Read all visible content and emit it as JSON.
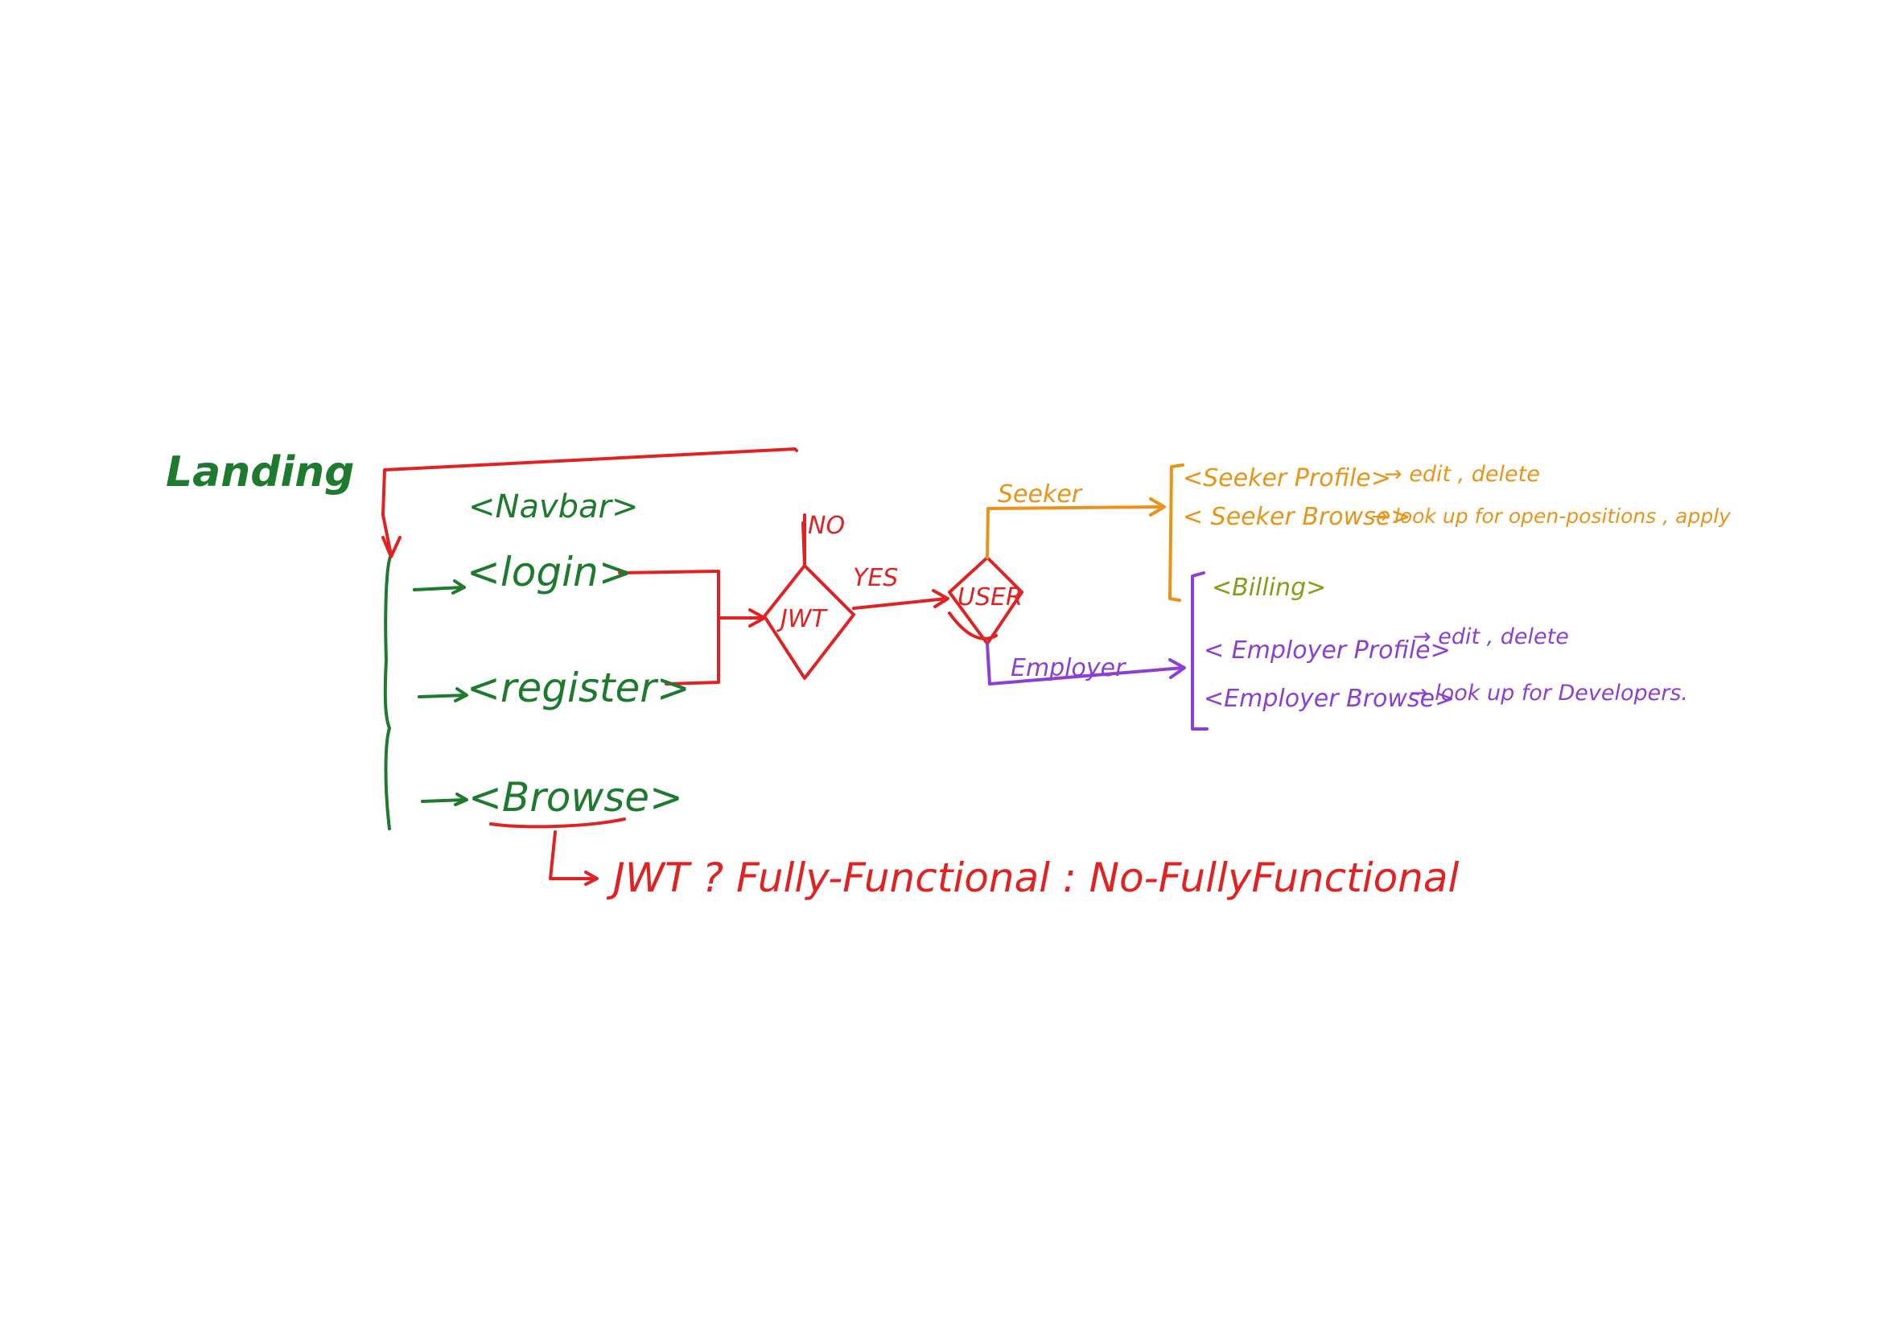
{
  "colors": {
    "green": "#1e7a2e",
    "red": "#e02222",
    "orange": "#e8941a",
    "purple": "#8a3fd6",
    "olive": "#8a9a1a"
  },
  "labels": {
    "landing": "Landing",
    "navbar": "<Navbar>",
    "login": "<login>",
    "register": "<register>",
    "browse": "<Browse>",
    "no": "NO",
    "yes": "YES",
    "jwt": "JWT",
    "user": "USER",
    "seeker": "Seeker",
    "employer": "Employer",
    "seeker_profile": "<Seeker Profile>",
    "seeker_profile_note": "→ edit , delete",
    "seeker_browse": "< Seeker Browse>",
    "seeker_browse_note": "→ look up for open-positions , apply",
    "billing": "<Billing>",
    "employer_profile": "< Employer Profile>",
    "employer_profile_note": "→ edit , delete",
    "employer_browse": "<Employer Browse>",
    "employer_browse_note": "→ look up for Developers.",
    "ternary": "JWT ? Fully-Functional : No-FullyFunctional"
  }
}
